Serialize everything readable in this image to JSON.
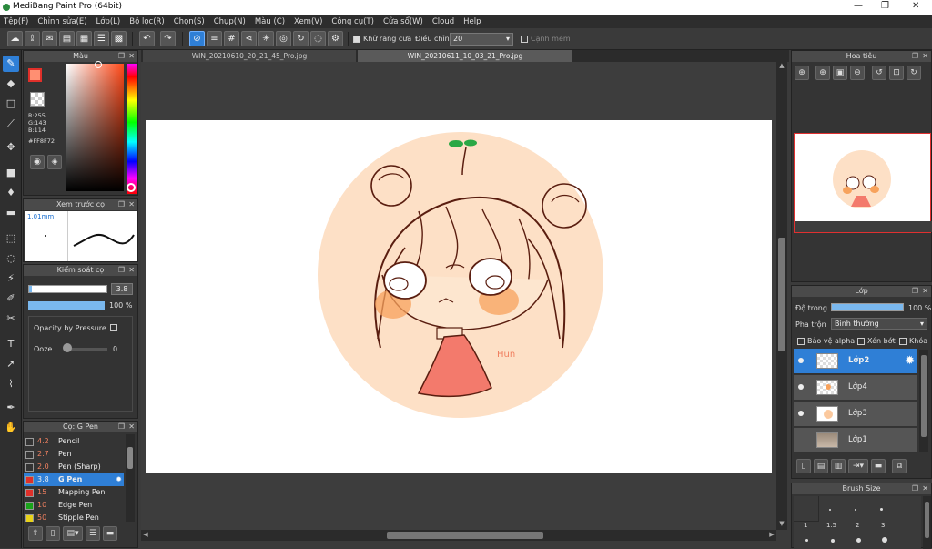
{
  "window": {
    "title": "MediBang Paint Pro (64bit)",
    "minimize": "—",
    "maximize": "❐",
    "close": "✕"
  },
  "menu": [
    "Tệp(F)",
    "Chỉnh sửa(E)",
    "Lớp(L)",
    "Bộ lọc(R)",
    "Chọn(S)",
    "Chụp(N)",
    "Màu (C)",
    "Xem(V)",
    "Công cụ(T)",
    "Cửa sổ(W)",
    "Cloud",
    "Help"
  ],
  "toolbar": {
    "antialias_label": "Khử răng cưa",
    "adjust_label": "Điều chỉnh",
    "adjust_value": "20",
    "edge_label": "Cạnh mềm"
  },
  "tabs": [
    "WIN_20210610_20_21_45_Pro.jpg",
    "WIN_20210611_10_03_21_Pro.jpg"
  ],
  "color_panel": {
    "title": "Màu",
    "r": "R:255",
    "g": "G:143",
    "b": "B:114",
    "hex": "#FF8F72",
    "accent": "#ff8f72"
  },
  "brush_preview": {
    "title": "Xem trước cọ",
    "size": "1.01mm"
  },
  "brush_control": {
    "title": "Kiểm soát cọ",
    "size_value": "3.8",
    "opacity_value": "100 %",
    "opacity_pressure_label": "Opacity by Pressure",
    "ooze_label": "Ooze",
    "ooze_value": "0"
  },
  "brush_list": {
    "title": "Cọ: G Pen",
    "items": [
      {
        "size": "4.2",
        "name": "Pencil",
        "color": "#333333",
        "selected": false
      },
      {
        "size": "2.7",
        "name": "Pen",
        "color": "#333333",
        "selected": false
      },
      {
        "size": "2.0",
        "name": "Pen (Sharp)",
        "color": "#333333",
        "selected": false
      },
      {
        "size": "3.8",
        "name": "G Pen",
        "color": "#e0302a",
        "selected": true
      },
      {
        "size": "15",
        "name": "Mapping Pen",
        "color": "#e0302a",
        "selected": false
      },
      {
        "size": "10",
        "name": "Edge Pen",
        "color": "#1aa31a",
        "selected": false
      },
      {
        "size": "50",
        "name": "Stipple Pen",
        "color": "#e8d21a",
        "selected": false
      }
    ]
  },
  "navigator": {
    "title": "Hoa tiêu"
  },
  "layer_panel": {
    "title": "Lớp",
    "opacity_label": "Độ trong",
    "opacity_value": "100 %",
    "blend_label": "Pha trộn",
    "blend_value": "Bình thường",
    "protect_alpha": "Bảo vệ alpha",
    "clipping": "Xén bớt",
    "lock": "Khóa",
    "layers": [
      {
        "name": "Lớp2",
        "selected": true
      },
      {
        "name": "Lớp4",
        "selected": false
      },
      {
        "name": "Lớp3",
        "selected": false
      },
      {
        "name": "Lớp1",
        "selected": false
      }
    ]
  },
  "brush_size_panel": {
    "title": "Brush Size",
    "row1": [
      "1",
      "1.5",
      "2",
      "3"
    ]
  },
  "canvas": {
    "signature": "Hun"
  }
}
